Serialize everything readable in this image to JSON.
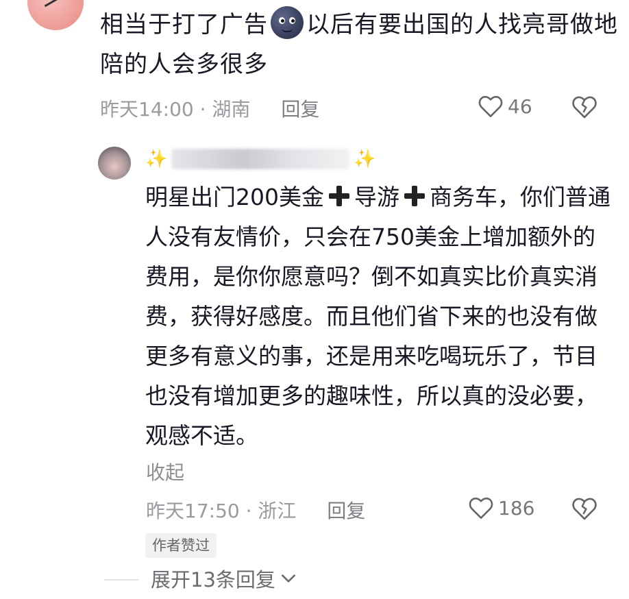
{
  "comment1": {
    "text_before": "相当于打了广告",
    "emoji": "new-moon-face-emoji",
    "text_after": "以后有要出国的人找亮哥做地陪的人会多很多",
    "time": "昨天14:00",
    "location": "湖南",
    "reply_label": "回复",
    "like_count": "46"
  },
  "reply1": {
    "username_decoration": "✨",
    "body_segments": [
      "明星出门200美金",
      "导游",
      "商务车，你们普通人没有友情价，只会在750美金上增加额外的费用，是你你愿意吗？倒不如真实比价真实消费，获得好感度。而且他们省下来的也没有做更多有意义的事，还是用来吃喝玩乐了，节目也没有增加更多的趣味性，所以真的没必要，观感不适。"
    ],
    "collapse_label": "收起",
    "time": "昨天17:50",
    "location": "浙江",
    "reply_label": "回复",
    "like_count": "186",
    "author_badge": "作者赞过"
  },
  "expand": {
    "label": "展开13条回复"
  },
  "colors": {
    "text": "#161823",
    "meta": "#9a9aa0",
    "sparkle": "#f1c84a"
  }
}
